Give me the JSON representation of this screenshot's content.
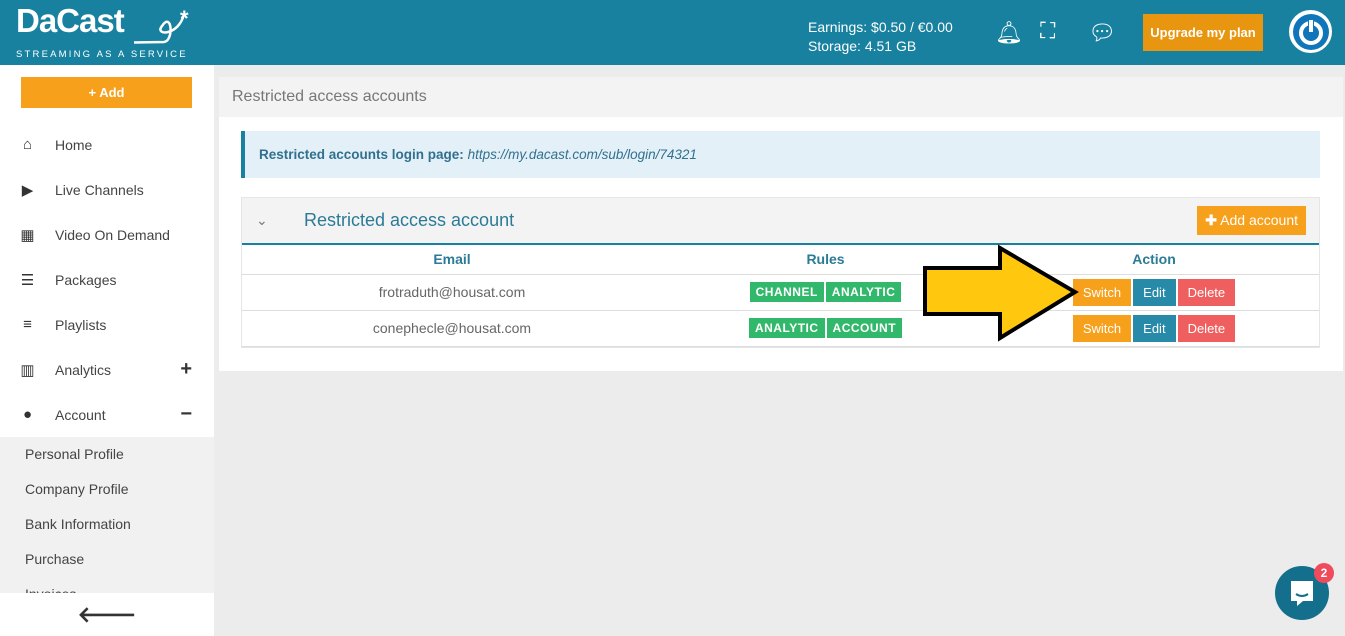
{
  "header": {
    "logo": "DaCast",
    "tagline": "STREAMING AS A SERVICE",
    "earnings": "Earnings: $0.50 / €0.00",
    "storage": "Storage: 4.51 GB",
    "upgrade": "Upgrade my plan",
    "icons": [
      "bell-icon",
      "fullscreen-icon",
      "chat-icon",
      "power-icon"
    ]
  },
  "sidebar": {
    "add": "+ Add",
    "items": [
      {
        "label": "Home",
        "icon": "home-icon"
      },
      {
        "label": "Live Channels",
        "icon": "play-icon"
      },
      {
        "label": "Video On Demand",
        "icon": "film-icon"
      },
      {
        "label": "Packages",
        "icon": "packages-icon"
      },
      {
        "label": "Playlists",
        "icon": "playlist-icon"
      },
      {
        "label": "Analytics",
        "icon": "chart-icon",
        "toggle": "+"
      },
      {
        "label": "Account",
        "icon": "user-icon",
        "toggle": "−"
      }
    ],
    "account_sub": [
      "Personal Profile",
      "Company Profile",
      "Bank Information",
      "Purchase",
      "Invoices"
    ]
  },
  "main": {
    "title": "Restricted access accounts",
    "info_label": "Restricted accounts login page:",
    "info_url": "https://my.dacast.com/sub/login/74321",
    "panel_title": "Restricted access account",
    "add_account": "Add account",
    "columns": [
      "Email",
      "Rules",
      "Action"
    ],
    "rows": [
      {
        "email": "frotraduth@housat.com",
        "rules": [
          "CHANNEL",
          "ANALYTIC"
        ]
      },
      {
        "email": "conephecle@housat.com",
        "rules": [
          "ANALYTIC",
          "ACCOUNT"
        ]
      }
    ],
    "actions": {
      "switch": "Switch",
      "edit": "Edit",
      "delete": "Delete"
    }
  },
  "chat": {
    "count": "2"
  },
  "colors": {
    "brand": "#17819f",
    "orange": "#f6a01b",
    "green": "#32b86b",
    "red": "#ef5f5f",
    "arrow": "#ffc80f"
  }
}
